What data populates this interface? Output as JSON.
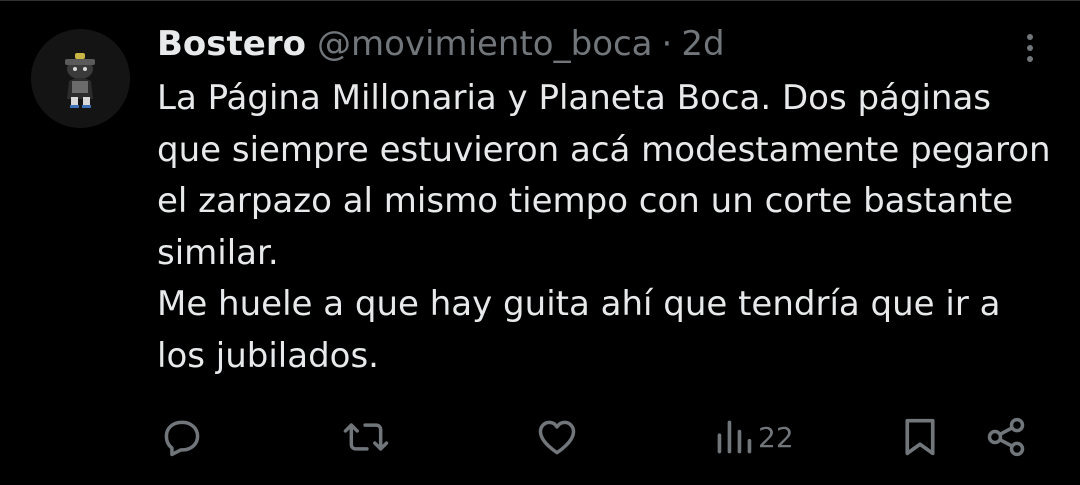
{
  "tweet": {
    "author_name": "Bostero",
    "handle": "@movimiento_boca",
    "separator": "·",
    "timestamp": "2d",
    "text": "La Página Millonaria y Planeta Boca. Dos páginas que siempre estuvieron acá modestamente pegaron el zarpazo al mismo tiempo con un corte bastante similar.\nMe huele a que hay guita ahí que tendría que ir a los jubilados."
  },
  "actions": {
    "reply": {
      "icon": "reply-icon"
    },
    "retweet": {
      "icon": "retweet-icon"
    },
    "like": {
      "icon": "heart-icon"
    },
    "views": {
      "icon": "views-icon",
      "count": "22"
    },
    "bookmark": {
      "icon": "bookmark-icon"
    },
    "share": {
      "icon": "share-icon"
    }
  },
  "colors": {
    "background": "#000000",
    "text_primary": "#e7e9ea",
    "text_secondary": "#71767b"
  }
}
